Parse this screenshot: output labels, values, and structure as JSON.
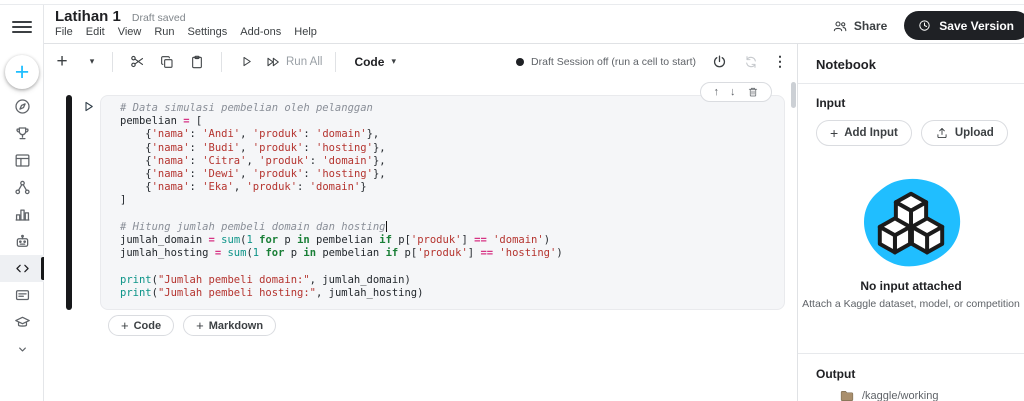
{
  "glyphs": {
    "plus": "+",
    "caret_down": "▾",
    "kebab": "⋮",
    "up_arrow": "↑",
    "down_arrow": "↓"
  },
  "colors": {
    "accent_blue": "#20beff",
    "save_button_bg": "#1f2125",
    "cell_bg": "#f5f6f8"
  },
  "header": {
    "title": "Latihan 1",
    "autosave_status": "Draft saved",
    "menu": [
      "File",
      "Edit",
      "View",
      "Run",
      "Settings",
      "Add-ons",
      "Help"
    ],
    "share_label": "Share",
    "save_version_label": "Save Version"
  },
  "toolbar": {
    "run_all_label": "Run All",
    "cell_type_label": "Code",
    "session_status": "Draft Session off (run a cell to start)"
  },
  "cell": {
    "code": [
      [
        {
          "c": "com",
          "t": "# Data simulasi pembelian oleh pelanggan"
        }
      ],
      [
        {
          "c": "v",
          "t": "pembelian "
        },
        {
          "c": "op",
          "t": "="
        },
        {
          "c": "v",
          "t": " ["
        }
      ],
      [
        {
          "c": "v",
          "t": "    {"
        },
        {
          "c": "str",
          "t": "'nama'"
        },
        {
          "c": "v",
          "t": ": "
        },
        {
          "c": "str",
          "t": "'Andi'"
        },
        {
          "c": "v",
          "t": ", "
        },
        {
          "c": "str",
          "t": "'produk'"
        },
        {
          "c": "v",
          "t": ": "
        },
        {
          "c": "str",
          "t": "'domain'"
        },
        {
          "c": "v",
          "t": "},"
        }
      ],
      [
        {
          "c": "v",
          "t": "    {"
        },
        {
          "c": "str",
          "t": "'nama'"
        },
        {
          "c": "v",
          "t": ": "
        },
        {
          "c": "str",
          "t": "'Budi'"
        },
        {
          "c": "v",
          "t": ", "
        },
        {
          "c": "str",
          "t": "'produk'"
        },
        {
          "c": "v",
          "t": ": "
        },
        {
          "c": "str",
          "t": "'hosting'"
        },
        {
          "c": "v",
          "t": "},"
        }
      ],
      [
        {
          "c": "v",
          "t": "    {"
        },
        {
          "c": "str",
          "t": "'nama'"
        },
        {
          "c": "v",
          "t": ": "
        },
        {
          "c": "str",
          "t": "'Citra'"
        },
        {
          "c": "v",
          "t": ", "
        },
        {
          "c": "str",
          "t": "'produk'"
        },
        {
          "c": "v",
          "t": ": "
        },
        {
          "c": "str",
          "t": "'domain'"
        },
        {
          "c": "v",
          "t": "},"
        }
      ],
      [
        {
          "c": "v",
          "t": "    {"
        },
        {
          "c": "str",
          "t": "'nama'"
        },
        {
          "c": "v",
          "t": ": "
        },
        {
          "c": "str",
          "t": "'Dewi'"
        },
        {
          "c": "v",
          "t": ", "
        },
        {
          "c": "str",
          "t": "'produk'"
        },
        {
          "c": "v",
          "t": ": "
        },
        {
          "c": "str",
          "t": "'hosting'"
        },
        {
          "c": "v",
          "t": "},"
        }
      ],
      [
        {
          "c": "v",
          "t": "    {"
        },
        {
          "c": "str",
          "t": "'nama'"
        },
        {
          "c": "v",
          "t": ": "
        },
        {
          "c": "str",
          "t": "'Eka'"
        },
        {
          "c": "v",
          "t": ", "
        },
        {
          "c": "str",
          "t": "'produk'"
        },
        {
          "c": "v",
          "t": ": "
        },
        {
          "c": "str",
          "t": "'domain'"
        },
        {
          "c": "v",
          "t": "}"
        }
      ],
      [
        {
          "c": "v",
          "t": "]"
        }
      ],
      [],
      [
        {
          "c": "com",
          "t": "# Hitung jumlah pembeli domain dan hosting"
        },
        {
          "c": "cur",
          "t": ""
        }
      ],
      [
        {
          "c": "v",
          "t": "jumlah_domain "
        },
        {
          "c": "op",
          "t": "="
        },
        {
          "c": "v",
          "t": " "
        },
        {
          "c": "fn",
          "t": "sum"
        },
        {
          "c": "v",
          "t": "("
        },
        {
          "c": "num",
          "t": "1"
        },
        {
          "c": "v",
          "t": " "
        },
        {
          "c": "kw",
          "t": "for"
        },
        {
          "c": "v",
          "t": " p "
        },
        {
          "c": "kw",
          "t": "in"
        },
        {
          "c": "v",
          "t": " pembelian "
        },
        {
          "c": "kw",
          "t": "if"
        },
        {
          "c": "v",
          "t": " p["
        },
        {
          "c": "str",
          "t": "'produk'"
        },
        {
          "c": "v",
          "t": "] "
        },
        {
          "c": "op",
          "t": "=="
        },
        {
          "c": "v",
          "t": " "
        },
        {
          "c": "str",
          "t": "'domain'"
        },
        {
          "c": "v",
          "t": ")"
        }
      ],
      [
        {
          "c": "v",
          "t": "jumlah_hosting "
        },
        {
          "c": "op",
          "t": "="
        },
        {
          "c": "v",
          "t": " "
        },
        {
          "c": "fn",
          "t": "sum"
        },
        {
          "c": "v",
          "t": "("
        },
        {
          "c": "num",
          "t": "1"
        },
        {
          "c": "v",
          "t": " "
        },
        {
          "c": "kw",
          "t": "for"
        },
        {
          "c": "v",
          "t": " p "
        },
        {
          "c": "kw",
          "t": "in"
        },
        {
          "c": "v",
          "t": " pembelian "
        },
        {
          "c": "kw",
          "t": "if"
        },
        {
          "c": "v",
          "t": " p["
        },
        {
          "c": "str",
          "t": "'produk'"
        },
        {
          "c": "v",
          "t": "] "
        },
        {
          "c": "op",
          "t": "=="
        },
        {
          "c": "v",
          "t": " "
        },
        {
          "c": "str",
          "t": "'hosting'"
        },
        {
          "c": "v",
          "t": ")"
        }
      ],
      [],
      [
        {
          "c": "fn",
          "t": "print"
        },
        {
          "c": "v",
          "t": "("
        },
        {
          "c": "str",
          "t": "\"Jumlah pembeli domain:\""
        },
        {
          "c": "v",
          "t": ", jumlah_domain)"
        }
      ],
      [
        {
          "c": "fn",
          "t": "print"
        },
        {
          "c": "v",
          "t": "("
        },
        {
          "c": "str",
          "t": "\"Jumlah pembeli hosting:\""
        },
        {
          "c": "v",
          "t": ", jumlah_hosting)"
        }
      ]
    ],
    "add_code_label": "Code",
    "add_markdown_label": "Markdown"
  },
  "right_panel": {
    "title": "Notebook",
    "input": {
      "heading": "Input",
      "add_input_label": "Add Input",
      "upload_label": "Upload",
      "empty_title": "No input attached",
      "empty_subtitle": "Attach a Kaggle dataset, model, or competition"
    },
    "output": {
      "heading": "Output",
      "partial_item": "/kaggle/working"
    }
  }
}
